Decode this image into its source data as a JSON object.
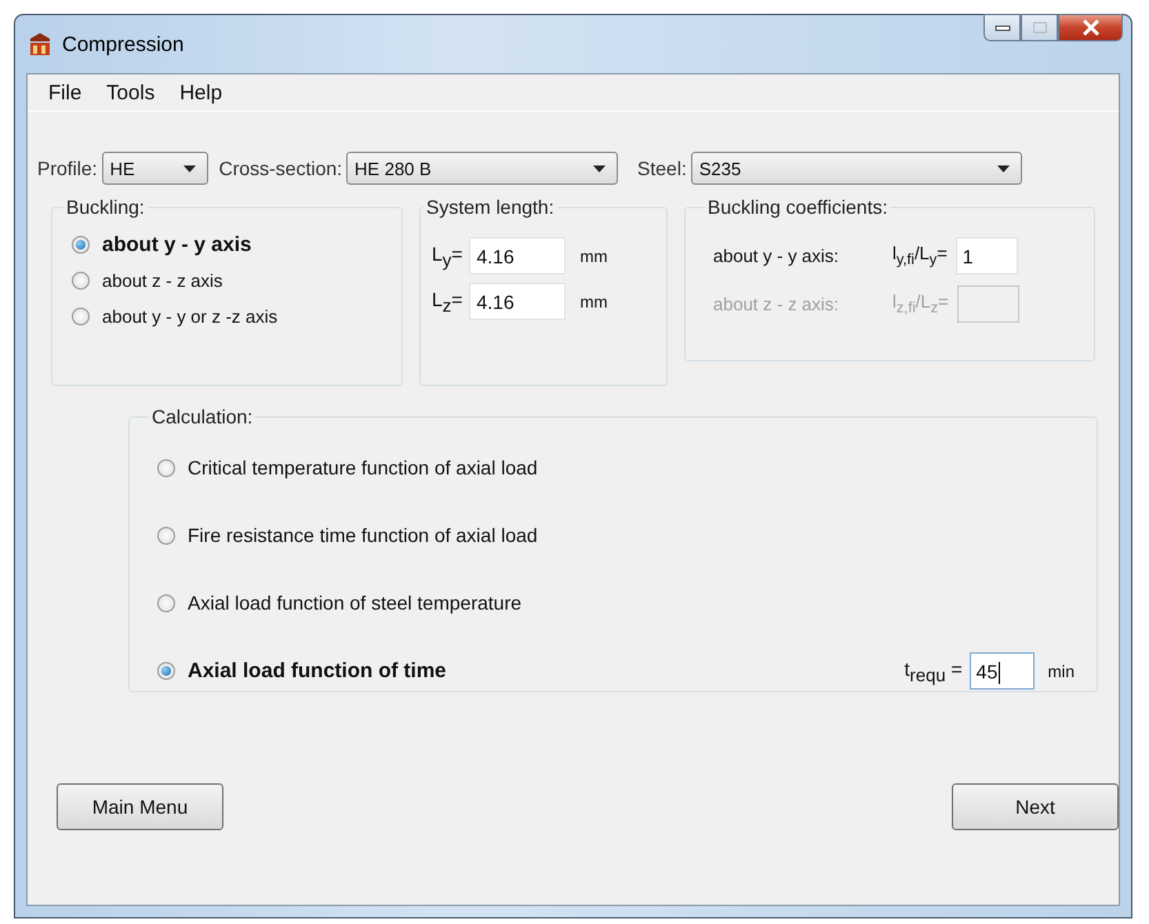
{
  "window": {
    "title": "Compression"
  },
  "menu": [
    "File",
    "Tools",
    "Help"
  ],
  "selectors": [
    {
      "label": "Profile:",
      "value": "HE",
      "kind": "short"
    },
    {
      "label": "Cross-section:",
      "value": "HE 280 B",
      "kind": "wide"
    },
    {
      "label": "Steel:",
      "value": "S235",
      "kind": "wide"
    }
  ],
  "buckling": {
    "title": "Buckling:",
    "options": [
      {
        "label": "about y - y axis",
        "selected": true
      },
      {
        "label": "about z - z axis",
        "selected": false
      },
      {
        "label": "about y - y or z -z axis",
        "selected": false
      }
    ]
  },
  "system_length": {
    "title": "System length:",
    "rows": [
      {
        "label": "L$_{y}$=",
        "value": "4.16",
        "unit": "mm"
      },
      {
        "label": "L$_{z}$=",
        "value": "4.16",
        "unit": "mm"
      }
    ]
  },
  "coefficients": {
    "title": "Buckling coefficients:",
    "rows": [
      {
        "label": "about y - y axis:",
        "ratio": "l$_{y,fi}$/L$_{y}$=",
        "value": "1",
        "disabled": false
      },
      {
        "label": "about z - z axis:",
        "ratio": "l$_{z,fi}$/L$_{z}$=",
        "disabled": true
      }
    ]
  },
  "calculation": {
    "title": "Calculation:",
    "options": [
      {
        "label": "Critical temperature function of axial load",
        "selected": false
      },
      {
        "label": "Fire resistance time function of axial load",
        "selected": false
      },
      {
        "label": "Axial load function of steel temperature",
        "selected": false
      },
      {
        "label": "Axial load function of time",
        "selected": true
      }
    ],
    "time_field": {
      "label": "t$_{requ}$ =",
      "value": "45",
      "unit": "min"
    }
  },
  "buttons": [
    "Main Menu",
    "Next"
  ]
}
